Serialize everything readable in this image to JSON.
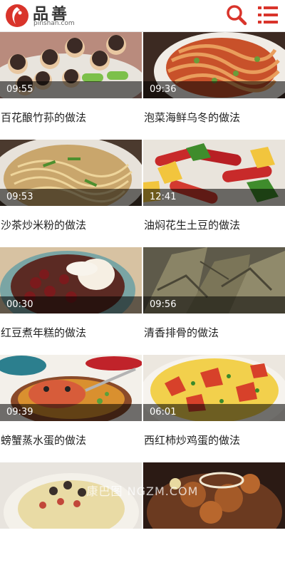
{
  "header": {
    "brand_name": "品善",
    "brand_domain": "pinshan.com",
    "search_icon": "search-icon",
    "menu_icon": "menu-icon",
    "accent": "#d9342b"
  },
  "recipes": [
    {
      "title": "百花酿竹荪的做法",
      "duration": "09:55"
    },
    {
      "title": "泡菜海鲜乌冬的做法",
      "duration": "09:36"
    },
    {
      "title": "沙茶炒米粉的做法",
      "duration": "09:53"
    },
    {
      "title": "油焖花生土豆的做法",
      "duration": "12:41"
    },
    {
      "title": "红豆煮年糕的做法",
      "duration": "00:30"
    },
    {
      "title": "清香排骨的做法",
      "duration": "09:56"
    },
    {
      "title": "螃蟹蒸水蛋的做法",
      "duration": "09:39"
    },
    {
      "title": "西红柿炒鸡蛋的做法",
      "duration": "06:01"
    },
    {
      "title": "",
      "duration": ""
    },
    {
      "title": "",
      "duration": ""
    }
  ],
  "watermark": "康巴图 NGZM.COM"
}
